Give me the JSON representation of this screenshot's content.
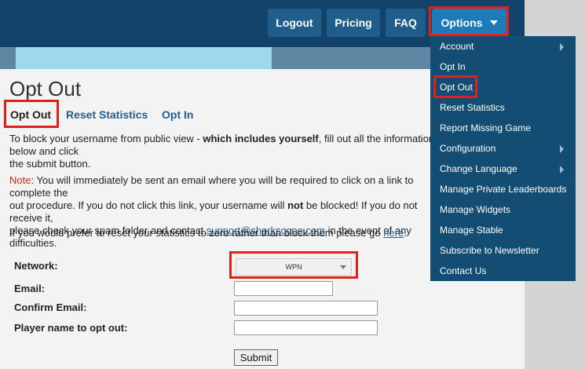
{
  "nav": {
    "logout": "Logout",
    "pricing": "Pricing",
    "faq": "FAQ",
    "options": "Options"
  },
  "page": {
    "title": "Opt Out",
    "tabs": [
      "Opt Out",
      "Reset Statistics",
      "Opt In"
    ]
  },
  "text": {
    "p1_a": "To block your username from public view - ",
    "p1_b": "which includes yourself",
    "p1_c": ", fill out all the information below and click",
    "p1_d": "the submit button.",
    "note_label": "Note",
    "p2_a": ": You will immediately be sent an email where you will be required to click on a link to complete the",
    "p2_b": "out procedure. If you do not click this link, your username will ",
    "p2_not": "not",
    "p2_c": " be blocked! If you do not receive it,",
    "p2_d": "please check your spam folder and contact ",
    "support_email": "support@sharkscope.com",
    "p2_e": " in the event of any difficulties.",
    "p3_a": "If you would prefer to reset your statistics to zero rather than block them please go ",
    "p3_link": "here",
    "p3_b": "."
  },
  "form": {
    "network_label": "Network:",
    "network_value": "WPN",
    "email_label": "Email:",
    "confirm_label": "Confirm Email:",
    "player_label": "Player name to opt out:",
    "submit_label": "Submit"
  },
  "menu": {
    "items": [
      {
        "label": "Account",
        "submenu": true
      },
      {
        "label": "Opt In",
        "submenu": false
      },
      {
        "label": "Opt Out",
        "submenu": false
      },
      {
        "label": "Reset Statistics",
        "submenu": false
      },
      {
        "label": "Report Missing Game",
        "submenu": false
      },
      {
        "label": "Configuration",
        "submenu": true
      },
      {
        "label": "Change Language",
        "submenu": true
      },
      {
        "label": "Manage Private Leaderboards",
        "submenu": false
      },
      {
        "label": "Manage Widgets",
        "submenu": false
      },
      {
        "label": "Manage Stable",
        "submenu": false
      },
      {
        "label": "Subscribe to Newsletter",
        "submenu": false
      },
      {
        "label": "Contact Us",
        "submenu": false
      }
    ]
  },
  "colors": {
    "header": "#13426a",
    "menu": "#134d73",
    "highlight": "#e0201a",
    "link": "#1d5e95"
  }
}
